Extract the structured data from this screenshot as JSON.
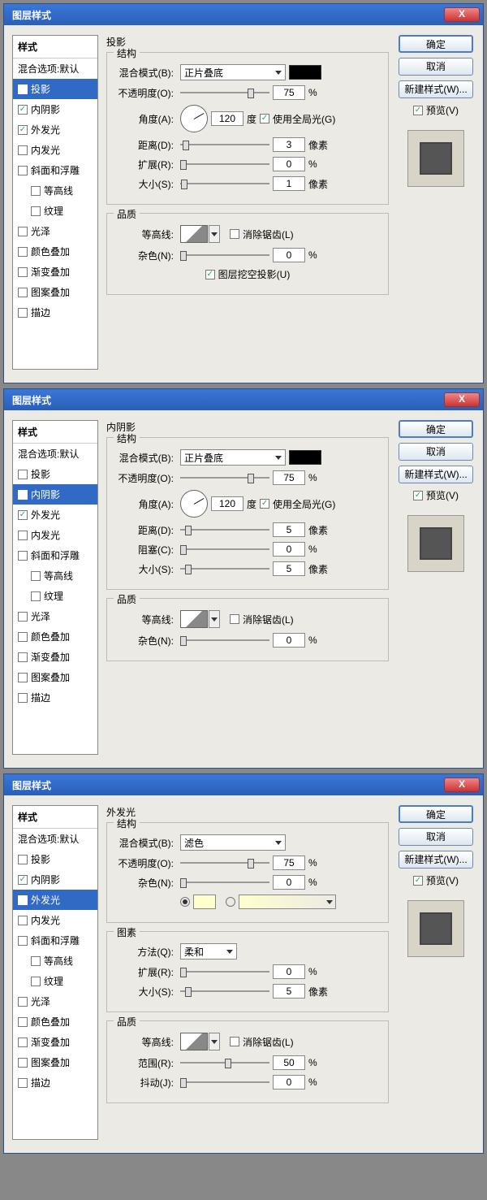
{
  "common": {
    "title": "图层样式",
    "close": "X",
    "ok": "确定",
    "cancel": "取消",
    "new_style": "新建样式(W)...",
    "preview": "预览(V)",
    "styles_header": "样式",
    "blending_options": "混合选项:默认",
    "styles": [
      {
        "key": "drop_shadow",
        "label": "投影"
      },
      {
        "key": "inner_shadow",
        "label": "内阴影"
      },
      {
        "key": "outer_glow",
        "label": "外发光"
      },
      {
        "key": "inner_glow",
        "label": "内发光"
      },
      {
        "key": "bevel",
        "label": "斜面和浮雕"
      },
      {
        "key": "contour_sub",
        "label": "等高线",
        "indent": true
      },
      {
        "key": "texture_sub",
        "label": "纹理",
        "indent": true
      },
      {
        "key": "satin",
        "label": "光泽"
      },
      {
        "key": "color_overlay",
        "label": "颜色叠加"
      },
      {
        "key": "gradient_overlay",
        "label": "渐变叠加"
      },
      {
        "key": "pattern_overlay",
        "label": "图案叠加"
      },
      {
        "key": "stroke",
        "label": "描边"
      }
    ],
    "labels": {
      "structure": "结构",
      "quality": "品质",
      "elements": "图素",
      "blend_mode": "混合模式(B):",
      "opacity": "不透明度(O):",
      "angle": "角度(A):",
      "degree": "度",
      "use_global": "使用全局光(G)",
      "distance": "距离(D):",
      "spread": "扩展(R):",
      "choke": "阻塞(C):",
      "size": "大小(S):",
      "pixels": "像素",
      "percent": "%",
      "contour": "等高线:",
      "anti_alias": "消除锯齿(L)",
      "noise": "杂色(N):",
      "knockout": "图层挖空投影(U)",
      "method": "方法(Q):",
      "range": "范围(R):",
      "jitter": "抖动(J):"
    }
  },
  "d1": {
    "panel_title": "投影",
    "selected": "drop_shadow",
    "checked": [
      "drop_shadow",
      "inner_shadow",
      "outer_glow"
    ],
    "blend_mode": "正片叠底",
    "opacity": "75",
    "angle": "120",
    "use_global": true,
    "distance": "3",
    "spread": "0",
    "size": "1",
    "anti_alias": false,
    "noise": "0",
    "knockout": true
  },
  "d2": {
    "panel_title": "内阴影",
    "selected": "inner_shadow",
    "checked": [
      "inner_shadow",
      "outer_glow"
    ],
    "blend_mode": "正片叠底",
    "opacity": "75",
    "angle": "120",
    "use_global": true,
    "distance": "5",
    "choke": "0",
    "size": "5",
    "anti_alias": false,
    "noise": "0"
  },
  "d3": {
    "panel_title": "外发光",
    "selected": "outer_glow",
    "checked": [
      "inner_shadow",
      "outer_glow"
    ],
    "blend_mode": "滤色",
    "opacity": "75",
    "noise": "0",
    "method": "柔和",
    "spread": "0",
    "size": "5",
    "anti_alias": false,
    "range": "50",
    "jitter": "0"
  }
}
